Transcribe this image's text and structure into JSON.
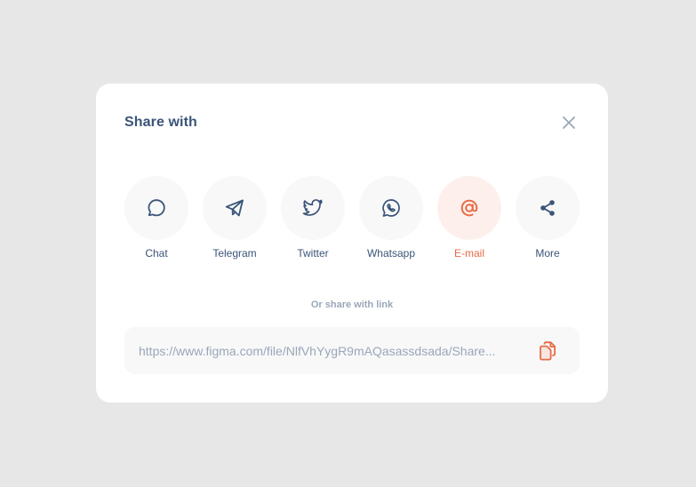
{
  "dialog": {
    "title": "Share with",
    "close_icon": "close-icon"
  },
  "share_options": [
    {
      "label": "Chat",
      "icon": "chat-bubble-icon",
      "active": false
    },
    {
      "label": "Telegram",
      "icon": "telegram-icon",
      "active": false
    },
    {
      "label": "Twitter",
      "icon": "twitter-icon",
      "active": false
    },
    {
      "label": "Whatsapp",
      "icon": "whatsapp-icon",
      "active": false
    },
    {
      "label": "E-mail",
      "icon": "at-sign-icon",
      "active": true
    },
    {
      "label": "More",
      "icon": "share-icon",
      "active": false
    }
  ],
  "link": {
    "caption": "Or share with link",
    "value": "https://www.figma.com/file/NlfVhYygR9mAQasassdsada/Share...",
    "copy_icon": "copy-icon"
  },
  "colors": {
    "background": "#e7e7e7",
    "dialog": "#ffffff",
    "text_primary": "#3b5478",
    "text_muted": "#9aa7b8",
    "accent": "#e86b48",
    "accent_bg": "#fdf0ec",
    "circle_bg": "#f8f8f9"
  }
}
